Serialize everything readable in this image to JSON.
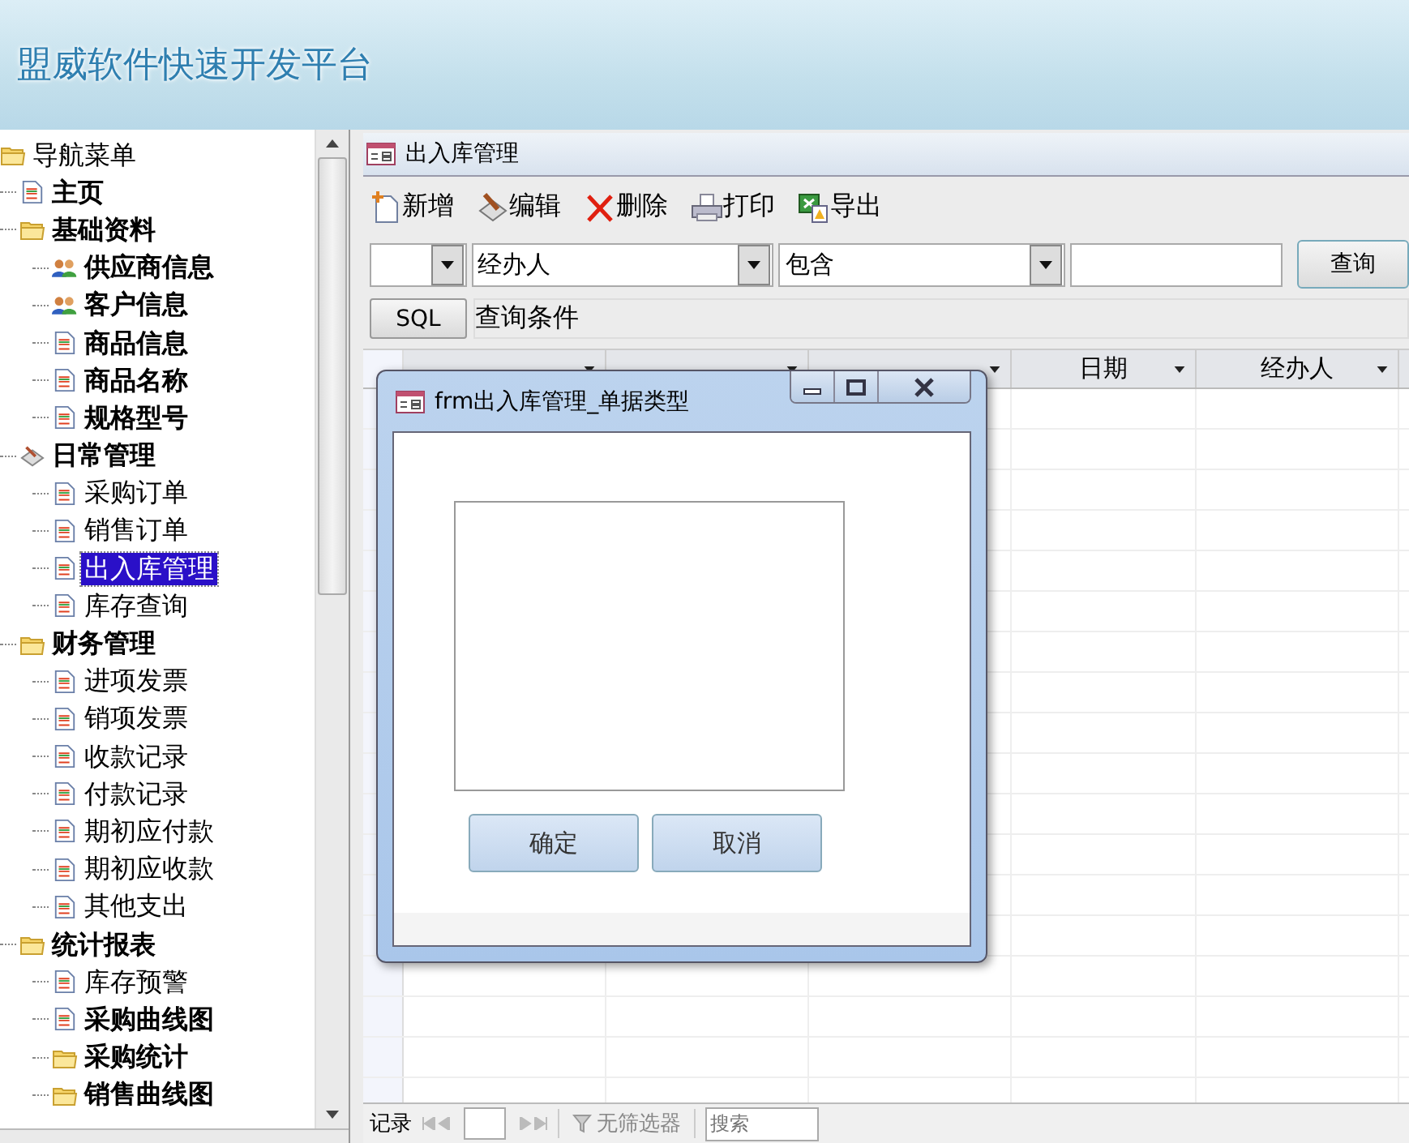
{
  "app_title": "盟威软件快速开发平台",
  "nav_tree": {
    "label": "导航菜单",
    "kind": "folder",
    "bold": false,
    "selected": false,
    "children": [
      {
        "label": "主页",
        "kind": "doc",
        "bold": true,
        "selected": false
      },
      {
        "label": "基础资料",
        "kind": "folder",
        "bold": true,
        "selected": false,
        "children": [
          {
            "label": "供应商信息",
            "kind": "people",
            "bold": true,
            "selected": false
          },
          {
            "label": "客户信息",
            "kind": "people",
            "bold": true,
            "selected": false
          },
          {
            "label": "商品信息",
            "kind": "doc",
            "bold": true,
            "selected": false
          },
          {
            "label": "商品名称",
            "kind": "doc",
            "bold": true,
            "selected": false
          },
          {
            "label": "规格型号",
            "kind": "doc",
            "bold": true,
            "selected": false
          }
        ]
      },
      {
        "label": "日常管理",
        "kind": "tools",
        "bold": true,
        "selected": false,
        "children": [
          {
            "label": "采购订单",
            "kind": "doc",
            "bold": false,
            "selected": false
          },
          {
            "label": "销售订单",
            "kind": "doc",
            "bold": false,
            "selected": false
          },
          {
            "label": "出入库管理",
            "kind": "doc",
            "bold": false,
            "selected": true
          },
          {
            "label": "库存查询",
            "kind": "doc",
            "bold": false,
            "selected": false
          }
        ]
      },
      {
        "label": "财务管理",
        "kind": "folder",
        "bold": true,
        "selected": false,
        "children": [
          {
            "label": "进项发票",
            "kind": "doc",
            "bold": false,
            "selected": false
          },
          {
            "label": "销项发票",
            "kind": "doc",
            "bold": false,
            "selected": false
          },
          {
            "label": "收款记录",
            "kind": "doc",
            "bold": false,
            "selected": false
          },
          {
            "label": "付款记录",
            "kind": "doc",
            "bold": false,
            "selected": false
          },
          {
            "label": "期初应付款",
            "kind": "doc",
            "bold": false,
            "selected": false
          },
          {
            "label": "期初应收款",
            "kind": "doc",
            "bold": false,
            "selected": false
          },
          {
            "label": "其他支出",
            "kind": "doc",
            "bold": false,
            "selected": false
          }
        ]
      },
      {
        "label": "统计报表",
        "kind": "folder",
        "bold": true,
        "selected": false,
        "children": [
          {
            "label": "库存预警",
            "kind": "doc",
            "bold": false,
            "selected": false
          },
          {
            "label": "采购曲线图",
            "kind": "doc",
            "bold": true,
            "selected": false
          },
          {
            "label": "采购统计",
            "kind": "folder",
            "bold": true,
            "selected": false
          },
          {
            "label": "销售曲线图",
            "kind": "folder",
            "bold": true,
            "selected": false
          }
        ]
      }
    ]
  },
  "document": {
    "title": "出入库管理",
    "toolbar": [
      {
        "label": "新增",
        "kind": "new"
      },
      {
        "label": "编辑",
        "kind": "edit"
      },
      {
        "label": "删除",
        "kind": "delete"
      },
      {
        "label": "打印",
        "kind": "print"
      },
      {
        "label": "导出",
        "kind": "export"
      }
    ],
    "filter": {
      "field_2": "经办人",
      "operator": "包含",
      "query_button": "查询"
    },
    "sql_button": "SQL",
    "condition_label": "查询条件",
    "grid": {
      "columns": [
        {
          "label": "日期"
        },
        {
          "label": "经办人"
        }
      ]
    },
    "status_bar": {
      "record_label": "记录",
      "filter_label": "无筛选器",
      "search_placeholder": "搜索"
    }
  },
  "dialog": {
    "title": "frm出入库管理_单据类型",
    "buttons": [
      "确定",
      "取消"
    ]
  }
}
